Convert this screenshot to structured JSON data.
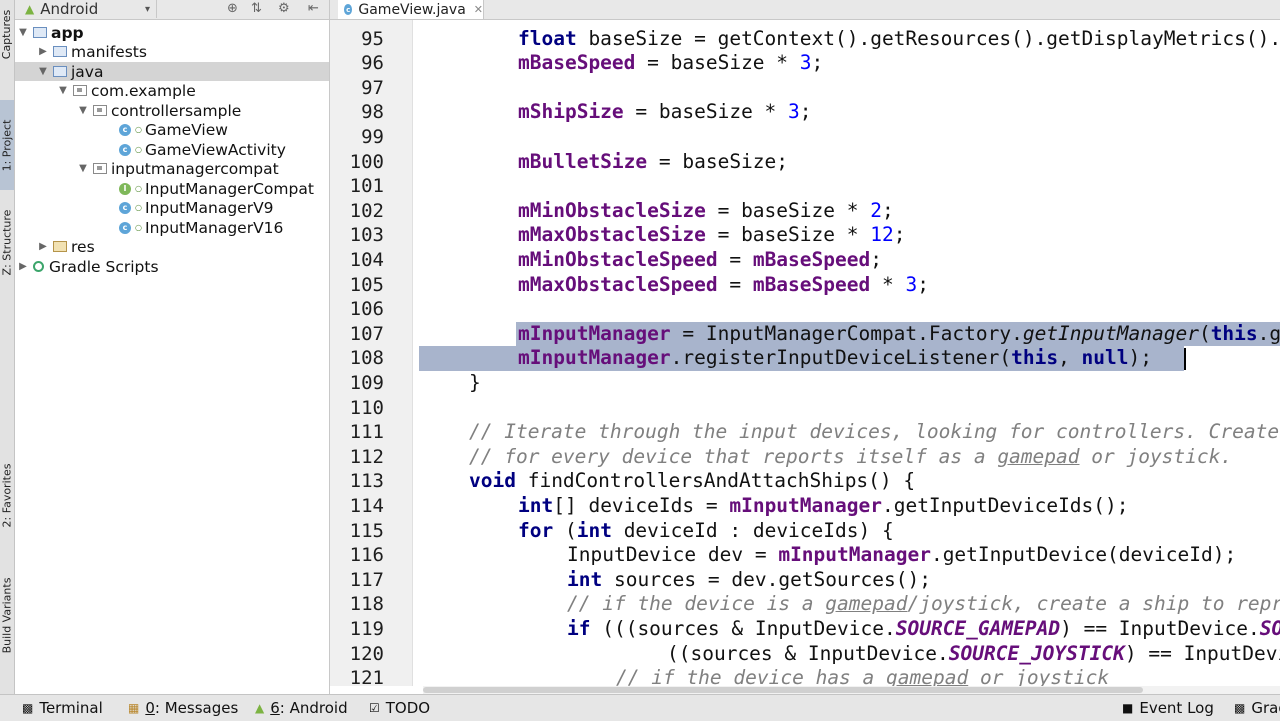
{
  "left_strip": {
    "tabs": [
      {
        "label": "Captures"
      },
      {
        "label": "1: Project"
      },
      {
        "label": "Z: Structure"
      },
      {
        "label": "2: Favorites"
      },
      {
        "label": "Build Variants"
      }
    ]
  },
  "project_panel": {
    "view_selector": "Android",
    "tree": [
      {
        "label": "app",
        "depth": 0,
        "expanded": true,
        "icon": "module-folder-icon"
      },
      {
        "label": "manifests",
        "depth": 1,
        "expanded": false,
        "icon": "folder-icon"
      },
      {
        "label": "java",
        "depth": 1,
        "expanded": true,
        "icon": "folder-icon",
        "selected": true
      },
      {
        "label": "com.example",
        "depth": 2,
        "expanded": true,
        "icon": "package-icon"
      },
      {
        "label": "controllersample",
        "depth": 3,
        "expanded": true,
        "icon": "package-icon"
      },
      {
        "label": "GameView",
        "depth": 4,
        "icon": "class-icon"
      },
      {
        "label": "GameViewActivity",
        "depth": 4,
        "icon": "class-icon"
      },
      {
        "label": "inputmanagercompat",
        "depth": 3,
        "expanded": true,
        "icon": "package-icon"
      },
      {
        "label": "InputManagerCompat",
        "depth": 4,
        "icon": "interface-icon"
      },
      {
        "label": "InputManagerV9",
        "depth": 4,
        "icon": "class-icon"
      },
      {
        "label": "InputManagerV16",
        "depth": 4,
        "icon": "class-icon"
      },
      {
        "label": "res",
        "depth": 1,
        "expanded": false,
        "icon": "res-folder-icon"
      },
      {
        "label": "Gradle Scripts",
        "depth": 0,
        "expanded": false,
        "icon": "gradle-icon"
      }
    ]
  },
  "editor": {
    "tab_label": "GameView.java",
    "line_numbers": [
      "95",
      "96",
      "97",
      "98",
      "99",
      "100",
      "101",
      "102",
      "103",
      "104",
      "105",
      "106",
      "107",
      "108",
      "109",
      "110",
      "111",
      "112",
      "113",
      "114",
      "115",
      "116",
      "117",
      "118",
      "119",
      "120",
      "121"
    ]
  },
  "bottom_bar": {
    "terminal": "Terminal",
    "messages_key": "0",
    "messages_rest": ": Messages",
    "android_key": "6",
    "android_rest": ": Android",
    "todo": "TODO",
    "event_log": "Event Log",
    "gradle": "Grad"
  }
}
